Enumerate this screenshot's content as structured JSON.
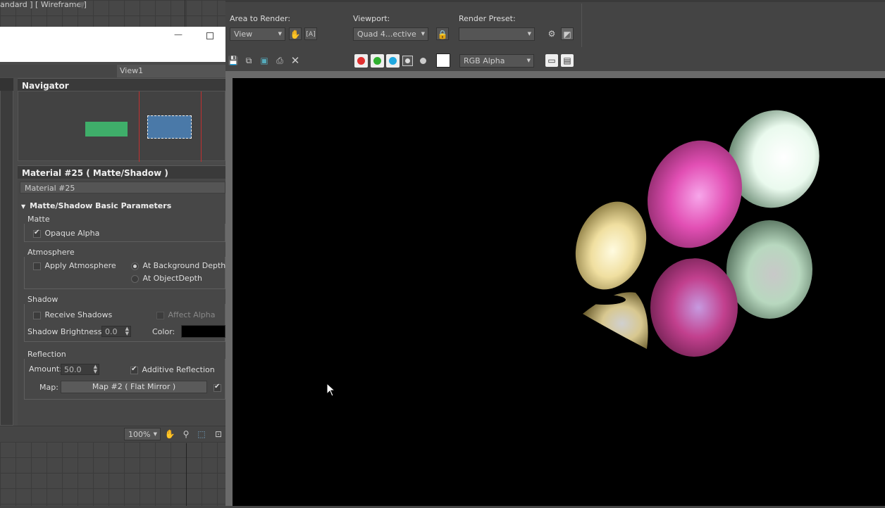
{
  "viewport": {
    "label": "andard ] [ Wireframe ]"
  },
  "slate": {
    "view_tab": "View1",
    "navigator_title": "Navigator",
    "material_header": "Material #25  ( Matte/Shadow )",
    "material_name": "Material #25",
    "rollout_title": "Matte/Shadow Basic Parameters",
    "matte": {
      "group": "Matte",
      "opaque_alpha": "Opaque Alpha"
    },
    "atmosphere": {
      "group": "Atmosphere",
      "apply_atmosphere": "Apply Atmosphere",
      "at_background_depth": "At Background Depth",
      "at_object_depth": "At ObjectDepth"
    },
    "shadow": {
      "group": "Shadow",
      "receive_shadows": "Receive Shadows",
      "affect_alpha": "Affect Alpha",
      "brightness_label": "Shadow Brightness:",
      "brightness_value": "0.0",
      "color_label": "Color:",
      "color_value": "#000000"
    },
    "reflection": {
      "group": "Reflection",
      "amount_label": "Amount:",
      "amount_value": "50.0",
      "additive_reflection": "Additive Reflection",
      "map_label": "Map:",
      "map_button": "Map #2  ( Flat Mirror )"
    },
    "zoom": "100%"
  },
  "render_frame": {
    "area_label": "Area to Render:",
    "area_value": "View",
    "viewport_label": "Viewport:",
    "viewport_value": "Quad 4...ective",
    "preset_label": "Render Preset:",
    "preset_value": "",
    "channel_value": "RGB Alpha",
    "channel_colors": [
      "#e03030",
      "#30b030",
      "#20a8e0"
    ]
  }
}
